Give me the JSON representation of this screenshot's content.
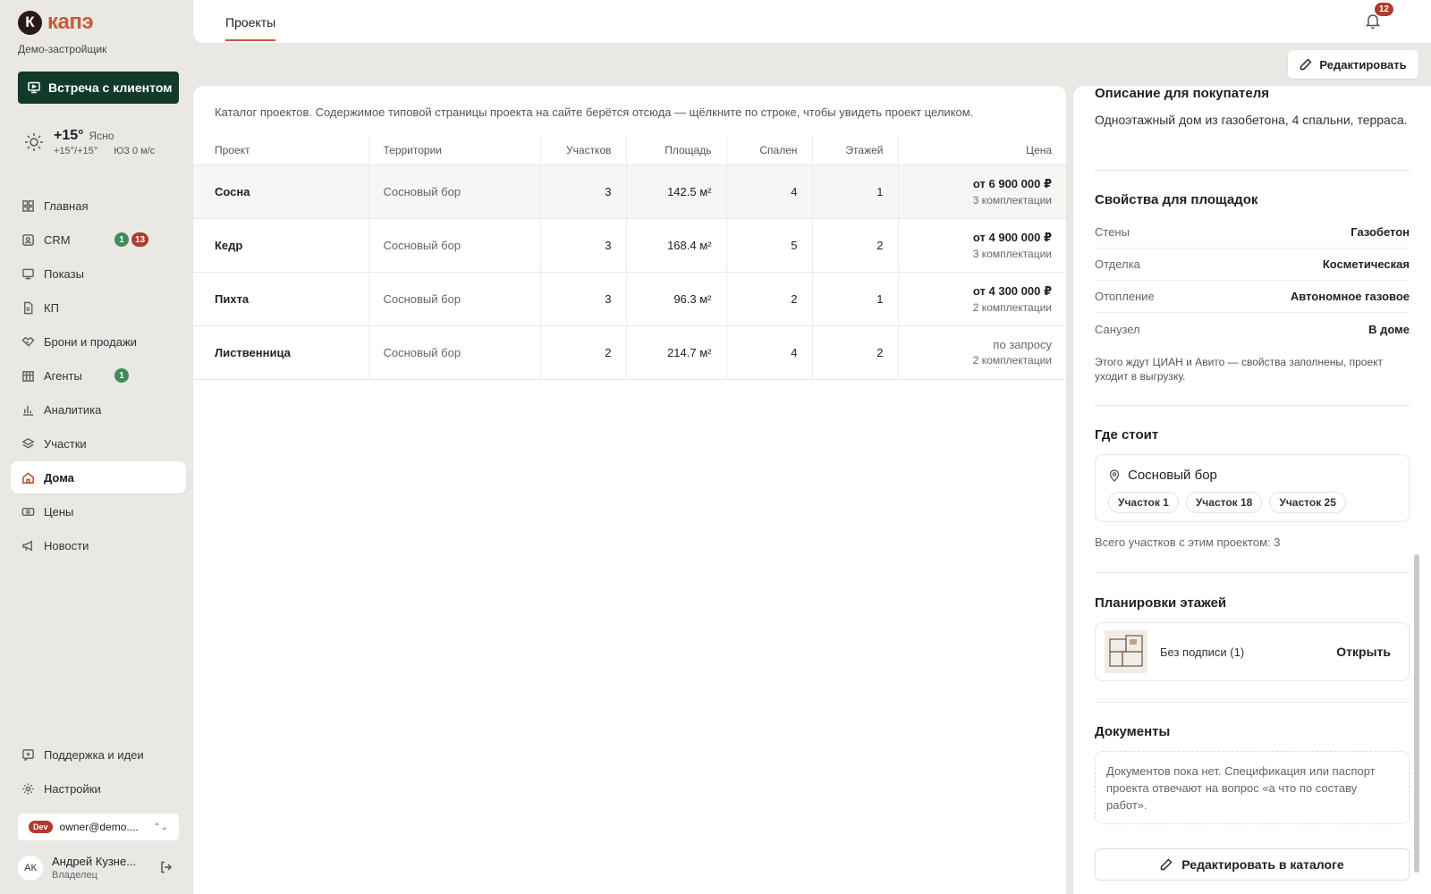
{
  "app": {
    "logo_letter": "К",
    "logo_text": "капэ",
    "org_name": "Демо-застройщик",
    "meet_button": "Встреча с клиентом",
    "brand_color": "#c85a36",
    "dark_green": "#113a2b"
  },
  "weather": {
    "temp": "+15°",
    "condition": "Ясно",
    "range": "+15°/+15°",
    "wind": "ЮЗ 0 м/с"
  },
  "nav": {
    "items": [
      {
        "label": "Главная",
        "icon": "grid-icon"
      },
      {
        "label": "CRM",
        "icon": "crm-icon",
        "badge_green": "1",
        "badge_red": "13"
      },
      {
        "label": "Показы",
        "icon": "monitor-icon"
      },
      {
        "label": "КП",
        "icon": "document-icon"
      },
      {
        "label": "Брони и продажи",
        "icon": "handshake-icon"
      },
      {
        "label": "Агенты",
        "icon": "building-icon",
        "badge_green": "1"
      },
      {
        "label": "Аналитика",
        "icon": "chart-icon"
      },
      {
        "label": "Участки",
        "icon": "plot-icon"
      },
      {
        "label": "Дома",
        "icon": "house-icon"
      },
      {
        "label": "Цены",
        "icon": "price-icon"
      },
      {
        "label": "Новости",
        "icon": "megaphone-icon"
      }
    ],
    "bottom": [
      {
        "label": "Поддержка и идеи",
        "icon": "support-icon"
      },
      {
        "label": "Настройки",
        "icon": "gear-icon"
      }
    ]
  },
  "account": {
    "env_badge": "Dev",
    "email": "owner@demo....",
    "user_initials": "АК",
    "user_name": "Андрей Кузне...",
    "user_role": "Владелец"
  },
  "topbar": {
    "tab": "Проекты",
    "notifications": "12"
  },
  "edit_button": "Редактировать",
  "catalog": {
    "intro": "Каталог проектов. Содержимое типовой страницы проекта на сайте берётся отсюда — щёлкните по строке, чтобы увидеть проект целиком.",
    "headers": {
      "project": "Проект",
      "territories": "Территории",
      "plots": "Участков",
      "area": "Площадь",
      "bedrooms": "Спален",
      "floors": "Этажей",
      "price": "Цена"
    },
    "rows": [
      {
        "project": "Сосна",
        "territory": "Сосновый бор",
        "plots": "3",
        "area": "142.5 м²",
        "bedrooms": "4",
        "floors": "1",
        "price": "от 6 900 000 ₽",
        "configs": "3 комплектации"
      },
      {
        "project": "Кедр",
        "territory": "Сосновый бор",
        "plots": "3",
        "area": "168.4 м²",
        "bedrooms": "5",
        "floors": "2",
        "price": "от 4 900 000 ₽",
        "configs": "3 комплектации"
      },
      {
        "project": "Пихта",
        "territory": "Сосновый бор",
        "plots": "3",
        "area": "96.3 м²",
        "bedrooms": "2",
        "floors": "1",
        "price": "от 4 300 000 ₽",
        "configs": "2 комплектации"
      },
      {
        "project": "Лиственница",
        "territory": "Сосновый бор",
        "plots": "2",
        "area": "214.7 м²",
        "bedrooms": "4",
        "floors": "2",
        "price": "по запросу",
        "configs": "2 комплектации"
      }
    ]
  },
  "details": {
    "buyer_desc_title": "Описание для покупателя",
    "buyer_desc": "Одноэтажный дом из газобетона, 4 спальни, терраса.",
    "props_title": "Свойства для площадок",
    "props": [
      {
        "key": "Стены",
        "value": "Газобетон"
      },
      {
        "key": "Отделка",
        "value": "Косметическая"
      },
      {
        "key": "Отопление",
        "value": "Автономное газовое"
      },
      {
        "key": "Санузел",
        "value": "В доме"
      }
    ],
    "props_note": "Этого ждут ЦИАН и Авито — свойства заполнены, проект уходит в выгрузку.",
    "location_title": "Где стоит",
    "location_name": "Сосновый бор",
    "location_plots": [
      "Участок 1",
      "Участок 18",
      "Участок 25"
    ],
    "location_total": "Всего участков с этим проектом: 3",
    "plans_title": "Планировки этажей",
    "plan_label": "Без подписи (1)",
    "plan_open": "Открыть",
    "docs_title": "Документы",
    "docs_empty": "Документов пока нет. Спецификация или паспорт проекта отвечают на вопрос «а что по составу работ».",
    "edit_catalog": "Редактировать в каталоге"
  }
}
